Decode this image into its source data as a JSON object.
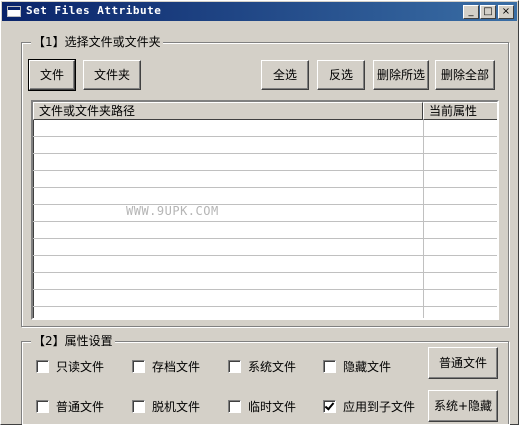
{
  "window": {
    "title": "Set Files Attribute",
    "minimize": "_",
    "maximize": "□",
    "close": "×"
  },
  "group1": {
    "label": "【1】选择文件或文件夹",
    "buttons": {
      "file": "文件",
      "folder": "文件夹",
      "select_all": "全选",
      "invert": "反选",
      "delete_selected": "删除所选",
      "delete_all": "删除全部"
    },
    "list": {
      "columns": [
        "文件或文件夹路径",
        "当前属性"
      ],
      "rows": [],
      "watermark": "WWW.9UPK.COM"
    }
  },
  "group2": {
    "label": "【2】属性设置",
    "checkboxes": [
      {
        "label": "只读文件",
        "checked": false
      },
      {
        "label": "存档文件",
        "checked": false
      },
      {
        "label": "系统文件",
        "checked": false
      },
      {
        "label": "隐藏文件",
        "checked": false
      },
      {
        "label": "普通文件",
        "checked": false
      },
      {
        "label": "脱机文件",
        "checked": false
      },
      {
        "label": "临时文件",
        "checked": false
      },
      {
        "label": "应用到子文件",
        "checked": true
      }
    ],
    "buttons": {
      "normal": "普通文件",
      "system_hidden": "系统+隐藏"
    }
  }
}
